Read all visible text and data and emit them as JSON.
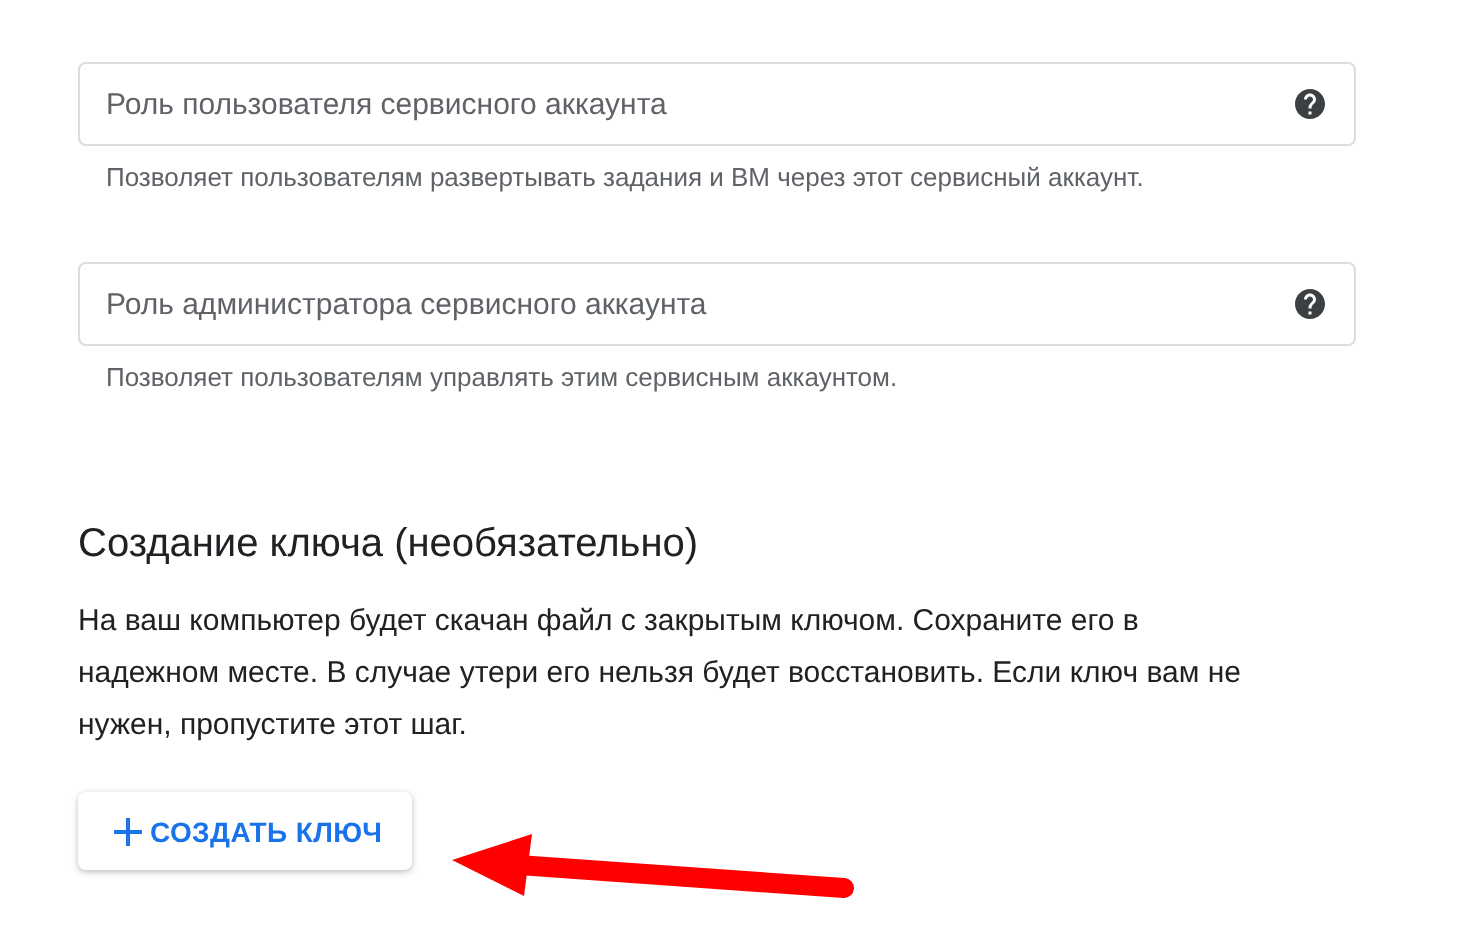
{
  "role_fields": [
    {
      "placeholder": "Роль пользователя сервисного аккаунта",
      "help": "Позволяет пользователям развертывать задания и ВМ через этот сервисный аккаунт."
    },
    {
      "placeholder": "Роль администратора сервисного аккаунта",
      "help": "Позволяет пользователям управлять этим сервисным аккаунтом."
    }
  ],
  "key_section": {
    "title": "Создание ключа (необязательно)",
    "description": "На ваш компьютер будет скачан файл с закрытым ключом. Сохраните его в надежном месте. В случае утери его нельзя будет восстановить. Если ключ вам не нужен, пропустите этот шаг.",
    "button": "СОЗДАТЬ КЛЮЧ"
  }
}
